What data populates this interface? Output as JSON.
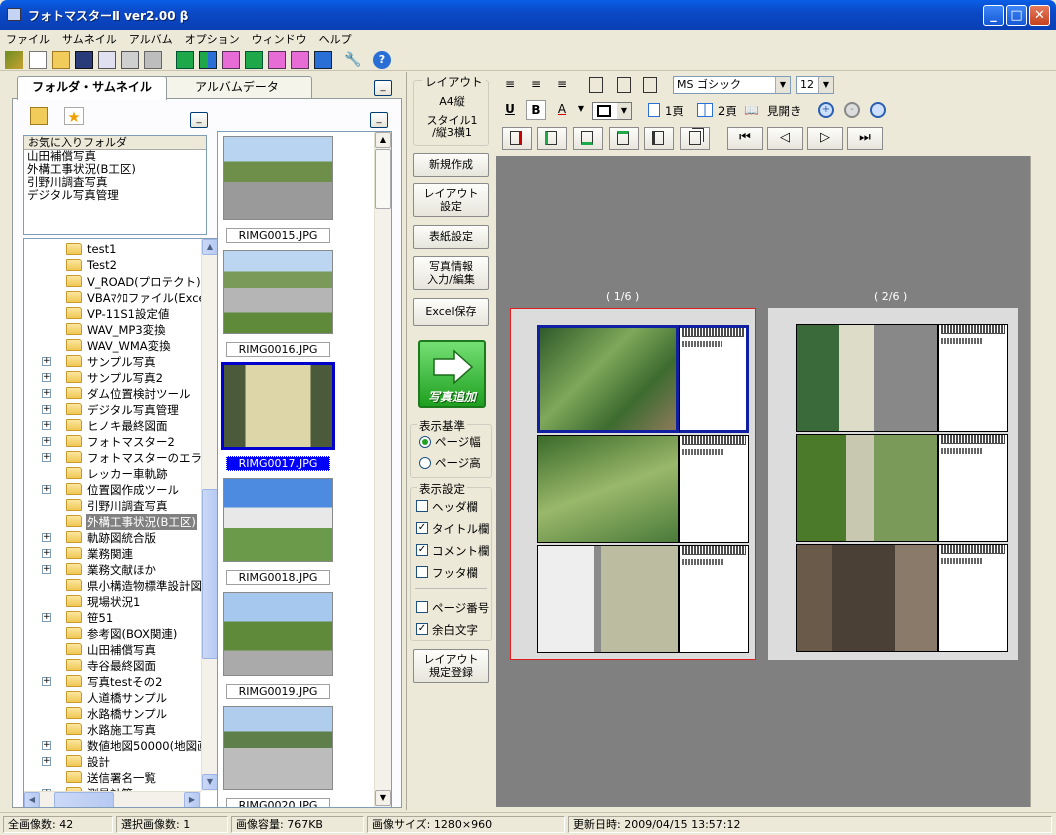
{
  "window": {
    "title": "フォトマスターⅡ  ver2.00 β"
  },
  "menu": [
    "ファイル",
    "サムネイル",
    "アルバム",
    "オプション",
    "ウィンドウ",
    "ヘルプ"
  ],
  "left_tabs": {
    "active": "フォルダ・サムネイル",
    "inactive": "アルバムデータ"
  },
  "favorites": {
    "header": "お気に入りフォルダ",
    "items": [
      "山田補償写真",
      "外構工事状況(B工区)",
      "引野川調査写真",
      "デジタル写真管理"
    ]
  },
  "tree": [
    {
      "label": "test1",
      "plus": false
    },
    {
      "label": "Test2",
      "plus": false
    },
    {
      "label": "V_ROAD(プロテクト)",
      "plus": false
    },
    {
      "label": "VBAﾏｸﾛファイル(Exce",
      "plus": false
    },
    {
      "label": "VP-11S1設定値",
      "plus": false
    },
    {
      "label": "WAV_MP3変換",
      "plus": false
    },
    {
      "label": "WAV_WMA変換",
      "plus": false
    },
    {
      "label": "サンプル写真",
      "plus": true
    },
    {
      "label": "サンプル写真2",
      "plus": true
    },
    {
      "label": "ダム位置検討ツール",
      "plus": true
    },
    {
      "label": "デジタル写真管理",
      "plus": true
    },
    {
      "label": "ヒノキ最終図面",
      "plus": true
    },
    {
      "label": "フォトマスター2",
      "plus": true
    },
    {
      "label": "フォトマスターのエラー",
      "plus": true
    },
    {
      "label": "レッカー車軌跡",
      "plus": false
    },
    {
      "label": "位置図作成ツール",
      "plus": true
    },
    {
      "label": "引野川調査写真",
      "plus": false
    },
    {
      "label": "外構工事状況(B工区)",
      "plus": false,
      "selected": true
    },
    {
      "label": "軌跡図統合版",
      "plus": true
    },
    {
      "label": "業務関連",
      "plus": true
    },
    {
      "label": "業務文献ほか",
      "plus": true
    },
    {
      "label": "県小構造物標準設計図",
      "plus": false
    },
    {
      "label": "現場状況1",
      "plus": false
    },
    {
      "label": "笹51",
      "plus": true
    },
    {
      "label": "参考図(BOX関連)",
      "plus": false
    },
    {
      "label": "山田補償写真",
      "plus": false
    },
    {
      "label": "寺谷最終図面",
      "plus": false
    },
    {
      "label": "写真testその2",
      "plus": true
    },
    {
      "label": "人道橋サンプル",
      "plus": false
    },
    {
      "label": "水路橋サンプル",
      "plus": false
    },
    {
      "label": "水路施工写真",
      "plus": false
    },
    {
      "label": "数値地図50000(地図画",
      "plus": true
    },
    {
      "label": "設計",
      "plus": true
    },
    {
      "label": "送信署名一覧",
      "plus": false
    },
    {
      "label": "測量計算",
      "plus": true
    }
  ],
  "thumbnails": [
    {
      "file": "RIMG0015.JPG",
      "selected": false
    },
    {
      "file": "RIMG0016.JPG",
      "selected": false
    },
    {
      "file": "RIMG0017.JPG",
      "selected": true
    },
    {
      "file": "RIMG0018.JPG",
      "selected": false
    },
    {
      "file": "RIMG0019.JPG",
      "selected": false
    },
    {
      "file": "RIMG0020.JPG",
      "selected": false
    }
  ],
  "layout_info": {
    "label": "レイアウト",
    "paper": "A4縦",
    "style": "スタイル1",
    "grid": "/縦3横1"
  },
  "side_buttons": {
    "new": "新規作成",
    "layout1": "レイアウト",
    "layout2": "設定",
    "cover": "表紙設定",
    "info1": "写真情報",
    "info2": "入力/編集",
    "excel": "Excel保存",
    "add_photo": "写真追加",
    "register1": "レイアウト",
    "register2": "規定登録"
  },
  "display_base": {
    "label": "表示基準",
    "options": [
      "ページ幅",
      "ページ高"
    ],
    "selected": 0
  },
  "display_settings": {
    "label": "表示設定",
    "items": [
      {
        "label": "ヘッダ欄",
        "checked": false
      },
      {
        "label": "タイトル欄",
        "checked": true
      },
      {
        "label": "コメント欄",
        "checked": true
      },
      {
        "label": "フッタ欄",
        "checked": false
      },
      {
        "label": "ページ番号",
        "checked": false
      },
      {
        "label": "余白文字",
        "checked": true
      }
    ]
  },
  "format_bar": {
    "font": "MS ゴシック",
    "size": "12",
    "page1": "1頁",
    "page2": "2頁",
    "spread": "見開き"
  },
  "pages": [
    {
      "label": "( 1/6 )"
    },
    {
      "label": "( 2/6 )"
    }
  ],
  "status": {
    "total": "全画像数: 42",
    "selected": "選択画像数: 1",
    "capacity": "画像容量: 767KB",
    "size": "画像サイズ: 1280×960",
    "updated": "更新日時: 2009/04/15 13:57:12"
  },
  "colors": {
    "accent": "#0a3fb5",
    "selection": "#0000cc",
    "canvas": "#808080",
    "green": "#3bbf3b"
  }
}
